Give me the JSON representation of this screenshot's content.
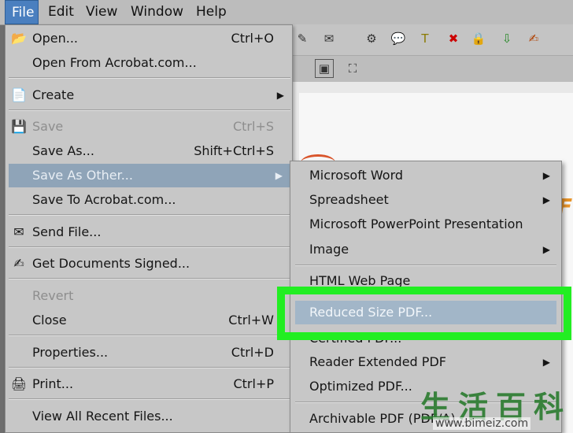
{
  "menubar": {
    "items": [
      "File",
      "Edit",
      "View",
      "Window",
      "Help"
    ]
  },
  "file_menu": {
    "open": "Open...",
    "open_sc": "Ctrl+O",
    "open_acrobat": "Open From Acrobat.com...",
    "create": "Create",
    "save": "Save",
    "save_sc": "Ctrl+S",
    "save_as": "Save As...",
    "save_as_sc": "Shift+Ctrl+S",
    "save_as_other": "Save As Other...",
    "save_to_acrobat": "Save To Acrobat.com...",
    "send_file": "Send File...",
    "get_signed": "Get Documents Signed...",
    "revert": "Revert",
    "close": "Close",
    "close_sc": "Ctrl+W",
    "properties": "Properties...",
    "properties_sc": "Ctrl+D",
    "print": "Print...",
    "print_sc": "Ctrl+P",
    "recent": "View All Recent Files..."
  },
  "submenu": {
    "word": "Microsoft Word",
    "spreadsheet": "Spreadsheet",
    "powerpoint": "Microsoft PowerPoint Presentation",
    "image": "Image",
    "html": "HTML Web Page",
    "reduced": "Reduced Size PDF...",
    "certified": "Certified PDF...",
    "reader_ext": "Reader Extended PDF",
    "optimized": "Optimized PDF...",
    "archivable": "Archivable PDF (PDF/A)..."
  },
  "watermark": {
    "chars": "生活百科",
    "url": "www.bimeiz.com"
  },
  "colors": {
    "menu_bg": "#c7c7c7",
    "highlight": "#8fa4b8",
    "active_menu": "#4a7fbf",
    "callout": "#22ee22"
  }
}
